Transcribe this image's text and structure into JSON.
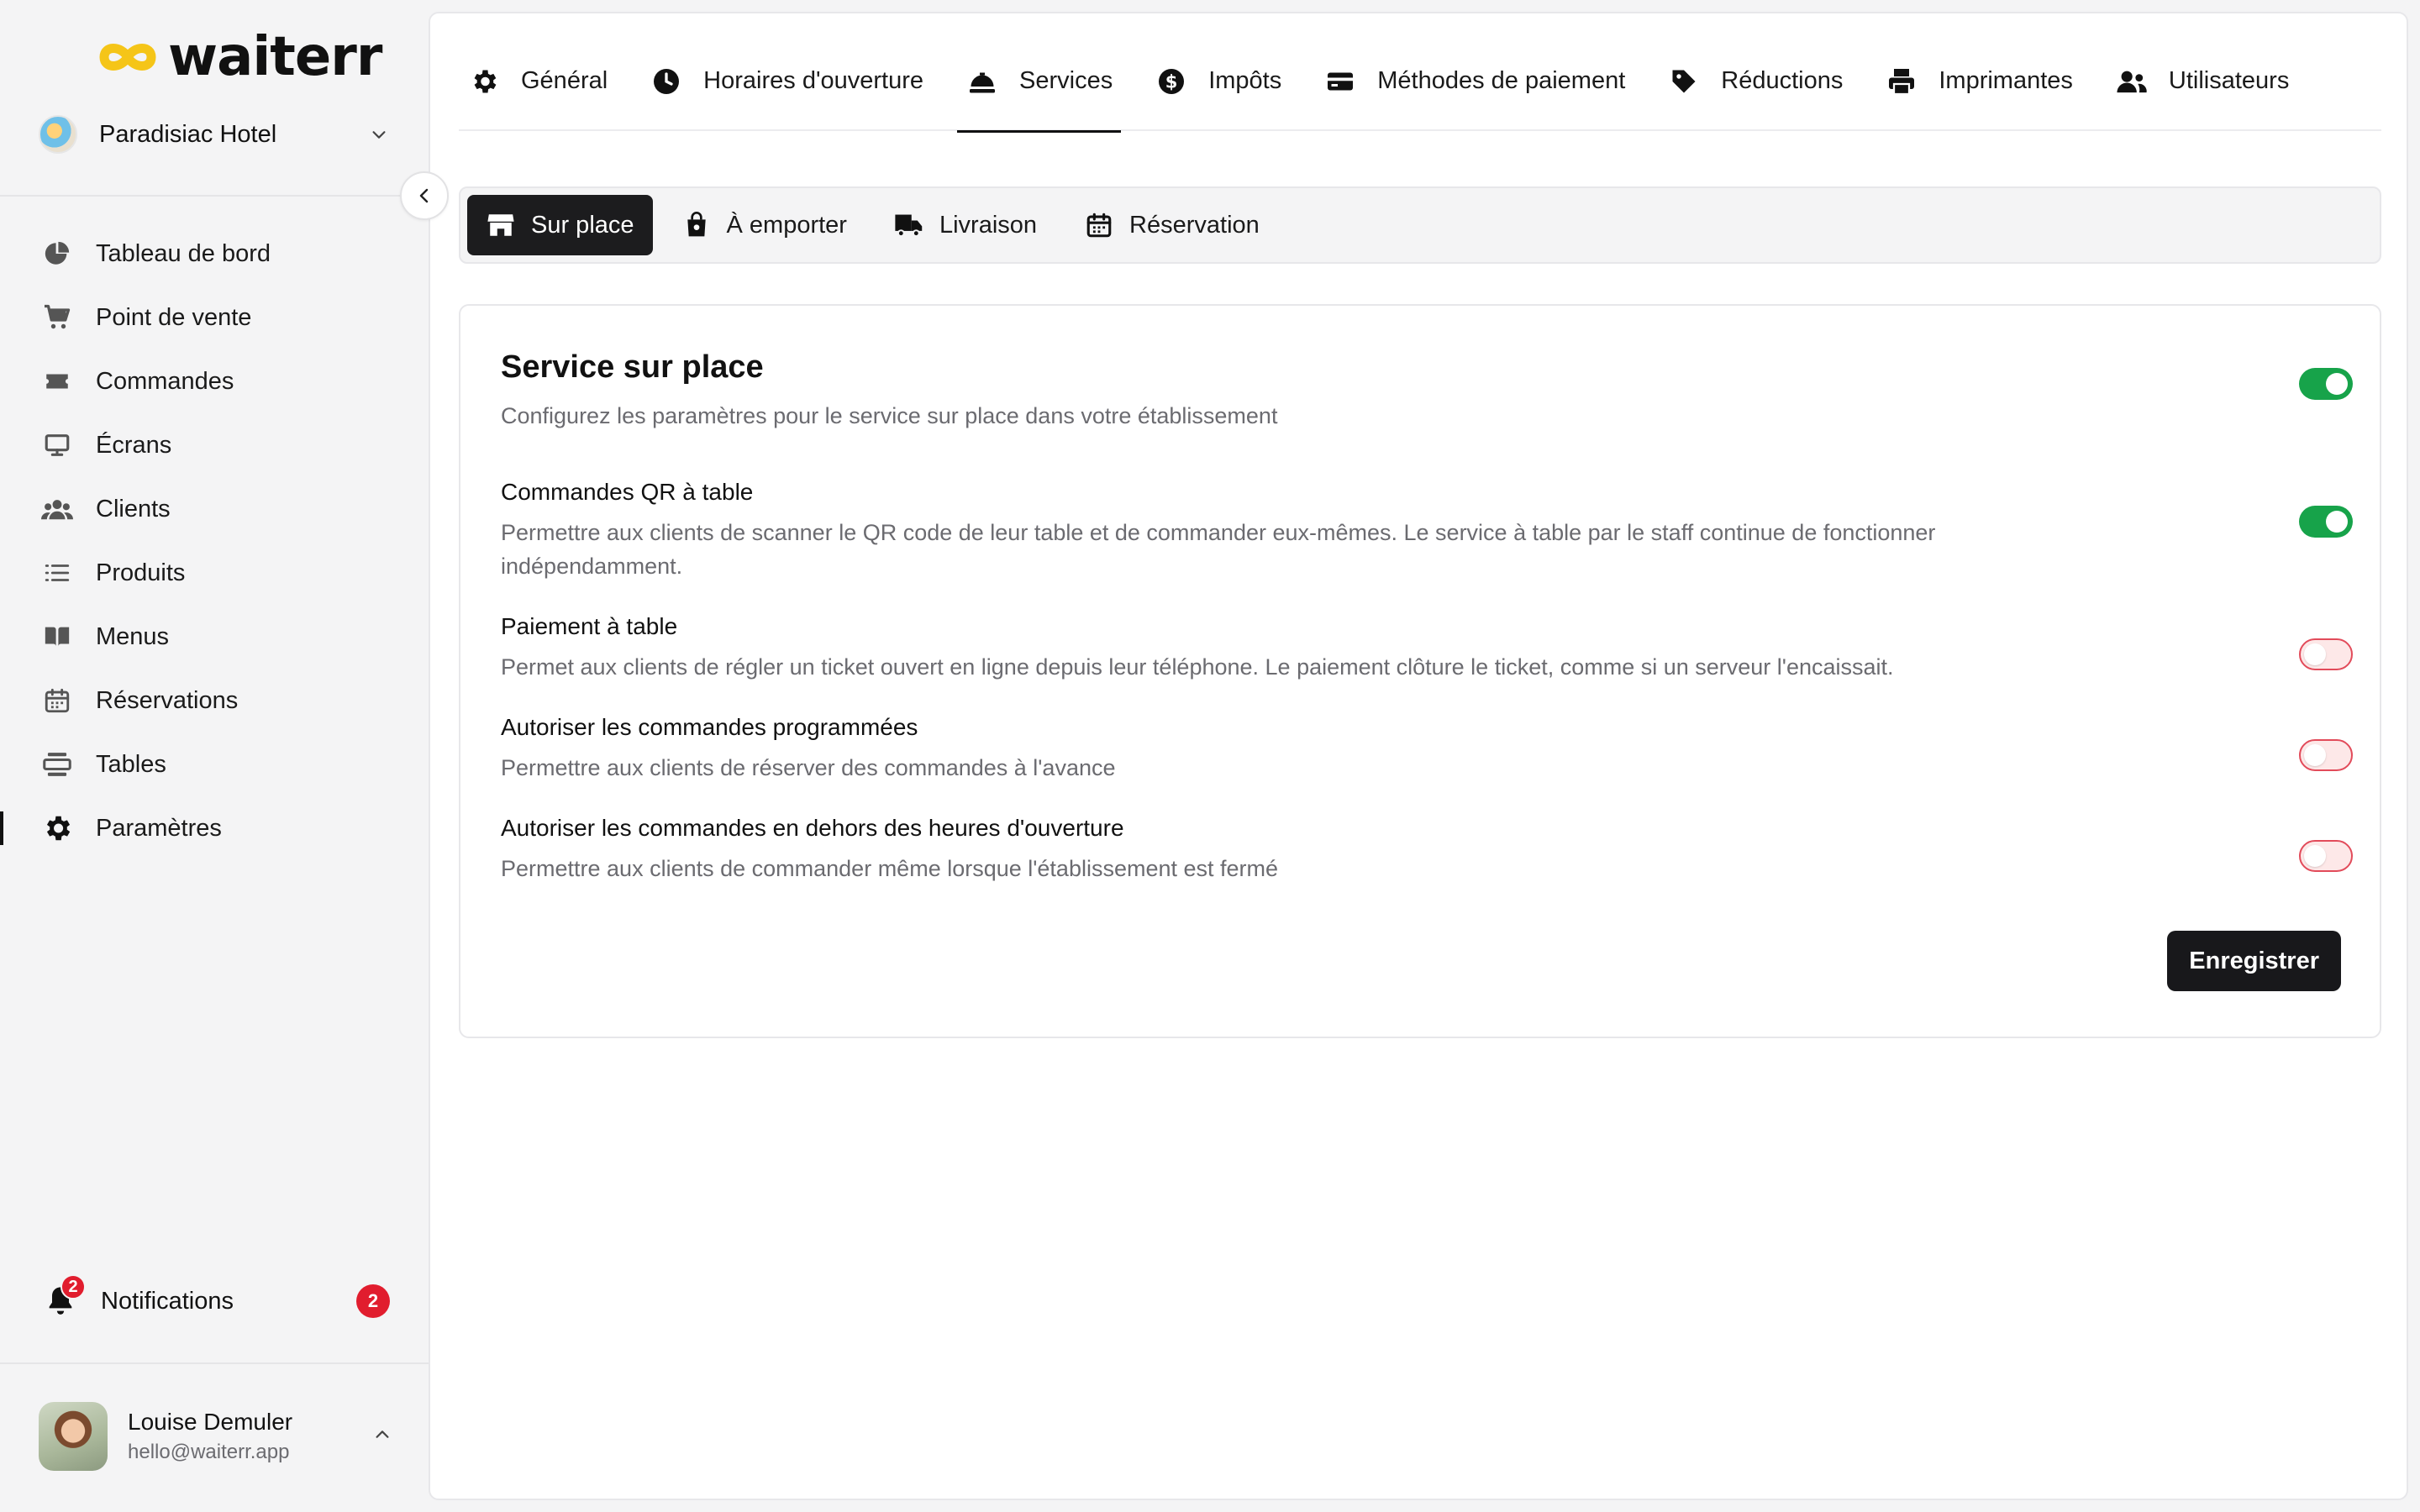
{
  "app": {
    "logo_text": "waiterr",
    "brand_color": "#f5c518"
  },
  "establishment": {
    "name": "Paradisiac Hotel"
  },
  "sidebar": {
    "items": [
      {
        "label": "Tableau de bord",
        "icon": "pie-chart-icon"
      },
      {
        "label": "Point de vente",
        "icon": "cart-icon"
      },
      {
        "label": "Commandes",
        "icon": "ticket-icon"
      },
      {
        "label": "Écrans",
        "icon": "monitor-icon"
      },
      {
        "label": "Clients",
        "icon": "users-icon"
      },
      {
        "label": "Produits",
        "icon": "list-icon"
      },
      {
        "label": "Menus",
        "icon": "book-icon"
      },
      {
        "label": "Réservations",
        "icon": "calendar-icon"
      },
      {
        "label": "Tables",
        "icon": "table-icon"
      },
      {
        "label": "Paramètres",
        "icon": "gear-icon",
        "active": true
      }
    ],
    "notifications": {
      "label": "Notifications",
      "count": "2",
      "badge": "2"
    },
    "user": {
      "name": "Louise Demuler",
      "email": "hello@waiterr.app"
    }
  },
  "top_tabs": [
    {
      "label": "Général",
      "icon": "gear-icon"
    },
    {
      "label": "Horaires d'ouverture",
      "icon": "clock-icon"
    },
    {
      "label": "Services",
      "icon": "cloche-icon",
      "active": true
    },
    {
      "label": "Impôts",
      "icon": "dollar-icon"
    },
    {
      "label": "Méthodes de paiement",
      "icon": "credit-card-icon"
    },
    {
      "label": "Réductions",
      "icon": "tag-icon"
    },
    {
      "label": "Imprimantes",
      "icon": "printer-icon"
    },
    {
      "label": "Utilisateurs",
      "icon": "user-group-icon"
    }
  ],
  "sub_tabs": [
    {
      "label": "Sur place",
      "icon": "store-icon",
      "active": true
    },
    {
      "label": "À emporter",
      "icon": "bag-icon"
    },
    {
      "label": "Livraison",
      "icon": "truck-icon"
    },
    {
      "label": "Réservation",
      "icon": "calendar-icon"
    }
  ],
  "card": {
    "title": "Service sur place",
    "description": "Configurez les paramètres pour le service sur place dans votre établissement",
    "enabled": true,
    "settings": [
      {
        "title": "Commandes QR à table",
        "description": "Permettre aux clients de scanner le QR code de leur table et de commander eux-mêmes. Le service à table par le staff continue de fonctionner indépendamment.",
        "enabled": true
      },
      {
        "title": "Paiement à table",
        "description": "Permet aux clients de régler un ticket ouvert en ligne depuis leur téléphone. Le paiement clôture le ticket, comme si un serveur l'encaissait.",
        "enabled": false
      },
      {
        "title": "Autoriser les commandes programmées",
        "description": "Permettre aux clients de réserver des commandes à l'avance",
        "enabled": false
      },
      {
        "title": "Autoriser les commandes en dehors des heures d'ouverture",
        "description": "Permettre aux clients de commander même lorsque l'établissement est fermé",
        "enabled": false
      }
    ],
    "save_label": "Enregistrer"
  },
  "colors": {
    "toggle_on": "#17a34a",
    "toggle_off_border": "#e24b5a",
    "notification_badge": "#e11d2e",
    "primary_button": "#18181b"
  }
}
